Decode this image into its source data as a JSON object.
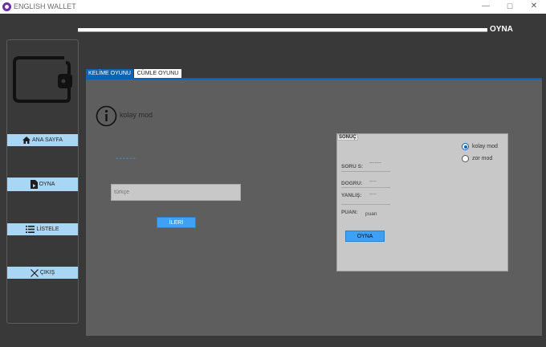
{
  "window": {
    "title": "ENGLISH WALLET",
    "minimize": "—",
    "maximize": "☐",
    "close": "✕"
  },
  "progress": {
    "value": 1.0
  },
  "header": {
    "title": "OYNA"
  },
  "sidebar": {
    "items": [
      {
        "label": "ANA SAYFA",
        "icon": "home-icon"
      },
      {
        "label": "OYNA",
        "icon": "file-play-icon"
      },
      {
        "label": "LİSTELE",
        "icon": "list-icon"
      },
      {
        "label": "ÇIKIŞ",
        "icon": "close-icon"
      }
    ]
  },
  "tabs": [
    {
      "label": "KELİME OYUNU",
      "active": true
    },
    {
      "label": "CÜMLE OYUNU",
      "active": false
    }
  ],
  "game": {
    "mode_label": "kolay mod",
    "word": "------",
    "input": {
      "value": "",
      "placeholder": "türkçe"
    },
    "next_label": "İLERİ"
  },
  "result": {
    "title": "SONUÇ",
    "modes": [
      {
        "label": "kolay mod",
        "selected": true
      },
      {
        "label": "zor mod",
        "selected": false
      }
    ],
    "question_label": "SORU S:",
    "question_value": "-------",
    "correct_label": "DOGRU:",
    "correct_value": "----",
    "wrong_label": "YANLIŞ:",
    "wrong_value": "----",
    "score_label": "PUAN:",
    "score_value": "puan",
    "play_label": "OYNA"
  },
  "colors": {
    "accent": "#0b63b7",
    "button": "#3ea1f5",
    "sidebar_button": "#aad6f5",
    "background": "#393939",
    "panel": "#5e5e5e"
  }
}
